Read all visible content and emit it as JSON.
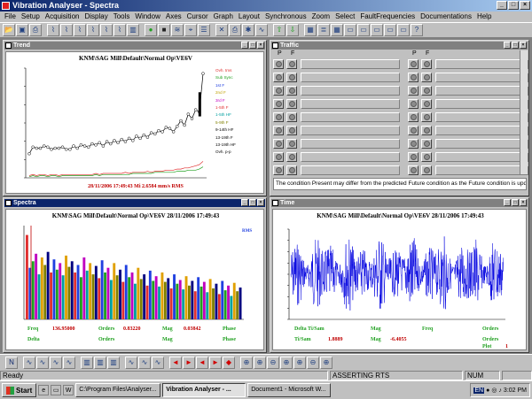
{
  "app": {
    "title": "Vibration Analyser - Spectra"
  },
  "menu": [
    "File",
    "Setup",
    "Acquisition",
    "Display",
    "Tools",
    "Window",
    "Axes",
    "Cursor",
    "Graph",
    "Layout",
    "Synchronous",
    "Zoom",
    "Select",
    "FaultFrequencies",
    "Documentations",
    "Help"
  ],
  "toolbar_icons": [
    "open-icon",
    "save-icon",
    "print-icon",
    "plot-icon",
    "plot-icon",
    "plot-icon",
    "plot-icon",
    "plot-icon",
    "plot-icon",
    "bar-plot-icon",
    "record-icon",
    "stop-icon",
    "overlay-icon",
    "cursor-icon",
    "waterfall-icon",
    "delete-icon",
    "print-icon",
    "settings-icon",
    "spectrum-icon",
    "up-arrow-icon",
    "down-arrow-icon",
    "grid-icon",
    "list-icon",
    "grid-icon",
    "window-icon",
    "window-icon",
    "window-icon",
    "window-icon",
    "window-icon",
    "help-icon"
  ],
  "windows": {
    "trend": {
      "caption": "Trend",
      "title": "KNM\\SAG Mill\\Default\\Normal Op\\VE6V",
      "readout": "28/11/2006 17:49:43  Mi 2.6584 mm/s RMS",
      "legend": [
        {
          "label": "Ovh. tms",
          "color": "#e03030"
        },
        {
          "label": "Sub Sync",
          "color": "#20a020"
        },
        {
          "label": "1st F",
          "color": "#2040e0"
        },
        {
          "label": "2nd F",
          "color": "#c0a000"
        },
        {
          "label": "3rd F",
          "color": "#c000c0"
        },
        {
          "label": "1-5th F",
          "color": "#e03030"
        },
        {
          "label": "1-5th HF",
          "color": "#00a0a0"
        },
        {
          "label": "5-9th F",
          "color": "#808000"
        },
        {
          "label": "9-14th HF",
          "color": "#000000"
        },
        {
          "label": "13-19th F",
          "color": "#000000"
        },
        {
          "label": "13-19th HF",
          "color": "#000000"
        },
        {
          "label": "Ovh. p-p",
          "color": "#000000"
        }
      ],
      "chart_data": {
        "type": "line",
        "series": [
          {
            "name": "Ovh. p-p",
            "color": "#000000",
            "values": [
              0.22,
              0.28,
              0.27,
              0.27,
              0.29,
              0.28,
              0.26,
              0.27,
              0.27,
              0.28,
              0.26,
              0.26,
              0.29,
              0.27,
              0.3,
              0.29,
              0.28,
              0.31,
              0.3,
              0.32,
              0.29,
              0.33,
              0.31,
              0.34,
              0.32,
              0.35,
              0.33,
              0.36,
              0.34,
              0.38,
              0.36,
              0.39,
              0.37,
              0.41,
              0.4,
              0.43,
              0.42,
              0.46,
              0.45,
              0.42,
              0.47,
              0.52,
              0.48,
              0.58,
              0.54,
              0.62,
              0.6,
              0.95
            ]
          },
          {
            "name": "Ovh. tms",
            "color": "#e03030",
            "values": [
              0.02,
              0.03,
              0.02,
              0.03,
              0.03,
              0.02,
              0.03,
              0.03,
              0.02,
              0.03,
              0.03,
              0.03,
              0.03,
              0.03,
              0.03,
              0.03,
              0.03,
              0.03,
              0.04,
              0.03,
              0.04,
              0.04,
              0.04,
              0.04,
              0.04,
              0.04,
              0.05,
              0.04,
              0.05,
              0.05,
              0.05,
              0.05,
              0.06,
              0.05,
              0.06,
              0.06,
              0.06,
              0.07,
              0.07,
              0.07,
              0.08,
              0.08,
              0.09,
              0.09,
              0.1,
              0.11,
              0.12,
              0.15
            ]
          },
          {
            "name": "Sub Sync",
            "color": "#20a020",
            "values": [
              0.01,
              0.02,
              0.01,
              0.02,
              0.02,
              0.01,
              0.02,
              0.02,
              0.01,
              0.02,
              0.02,
              0.02,
              0.02,
              0.02,
              0.02,
              0.02,
              0.02,
              0.02,
              0.03,
              0.02,
              0.03,
              0.03,
              0.03,
              0.03,
              0.03,
              0.03,
              0.03,
              0.03,
              0.04,
              0.04,
              0.04,
              0.04,
              0.04,
              0.04,
              0.05,
              0.05,
              0.05,
              0.05,
              0.05,
              0.05,
              0.06,
              0.06,
              0.06,
              0.07,
              0.07,
              0.07,
              0.08,
              0.1
            ]
          }
        ]
      }
    },
    "traffic": {
      "caption": "Traffic",
      "col_headers": [
        "P",
        "F",
        "P",
        "F"
      ],
      "rows": 9,
      "note": "The condition Present may differ from the predicted Future condition as the Future condition is updat"
    },
    "spectra": {
      "caption": "Spectra",
      "title": "KNM\\SAG Mill\\Default\\Normal Op\\VE6V 28/11/2006 17:49:43",
      "unit": "RMS",
      "readout": {
        "freq_label": "Freq",
        "freq_value": "136.95000",
        "orders_label": "Orders",
        "orders_value": "0.83220",
        "mag_label": "Mag",
        "mag_value": "0.03842",
        "phase_label": "Phase",
        "delta_label": "Delta",
        "orders2_label": "Orders",
        "mag2_label": "Mag",
        "phase2_label": "Phase"
      },
      "chart_data": {
        "type": "bar",
        "colors": [
          "#e03030",
          "#2040e0",
          "#20a020",
          "#c000c0",
          "#00a0a0",
          "#e0a000",
          "#808000",
          "#000080"
        ],
        "values": [
          0.9,
          0.55,
          0.62,
          0.7,
          0.48,
          0.66,
          0.58,
          0.72,
          0.5,
          0.64,
          0.53,
          0.6,
          0.47,
          0.68,
          0.56,
          0.62,
          0.5,
          0.58,
          0.45,
          0.66,
          0.52,
          0.6,
          0.48,
          0.57,
          0.44,
          0.63,
          0.5,
          0.55,
          0.42,
          0.6,
          0.47,
          0.53,
          0.4,
          0.58,
          0.45,
          0.5,
          0.38,
          0.55,
          0.43,
          0.48,
          0.36,
          0.52,
          0.41,
          0.46,
          0.35,
          0.5,
          0.4,
          0.44,
          0.33,
          0.48,
          0.38,
          0.42,
          0.32,
          0.46,
          0.36,
          0.41,
          0.3,
          0.45,
          0.35,
          0.4,
          0.29,
          0.43,
          0.33,
          0.38,
          0.27,
          0.41,
          0.31,
          0.36,
          0.25,
          0.39,
          0.3,
          0.34
        ]
      }
    },
    "time": {
      "caption": "Time",
      "title": "KNM\\SAG Mill\\Default\\Normal Op\\VE6V 28/11/2006 17:49:43",
      "readout": {
        "delta_label": "Delta Ti/Sam",
        "mag_label": "Mag",
        "freq_label": "Freq",
        "orders_label": "Orders",
        "tisam_label": "Ti/Sam",
        "tisam_value": "1.8889",
        "mag2_label": "Mag",
        "mag2_value": "-6.4055",
        "orders2_label": "Orders",
        "plot_label": "Plot",
        "plot_value": "1"
      },
      "chart_data": {
        "type": "line",
        "series": [
          {
            "color": "#0000e0"
          }
        ]
      }
    }
  },
  "bottom_toolbar_icons": [
    "n-marker-icon",
    "waveform-icon",
    "waveform-icon",
    "waveform-icon",
    "waveform-icon",
    "bars-icon",
    "bars-icon",
    "bars-icon",
    "waveform-icon",
    "waveform-icon",
    "waveform-icon",
    "red-left-arrow-icon",
    "red-right-arrow-icon",
    "red-left-arrow-icon",
    "red-right-arrow-icon",
    "red-double-arrow-icon",
    "zoom-in-icon",
    "zoom-in-icon",
    "zoom-out-icon",
    "zoom-in-icon",
    "zoom-in-icon",
    "zoom-out-icon",
    "zoom-in-icon"
  ],
  "status": {
    "left": "Ready",
    "mid": "ASSERTING RTS",
    "num": "NUM"
  },
  "taskbar": {
    "start": "Start",
    "tasks": [
      "C:\\Program Files\\Analyser...",
      "Vibration Analyser - ...",
      "Document1 - Microsoft W..."
    ],
    "clock": "3:02 PM",
    "lang": "EN"
  }
}
